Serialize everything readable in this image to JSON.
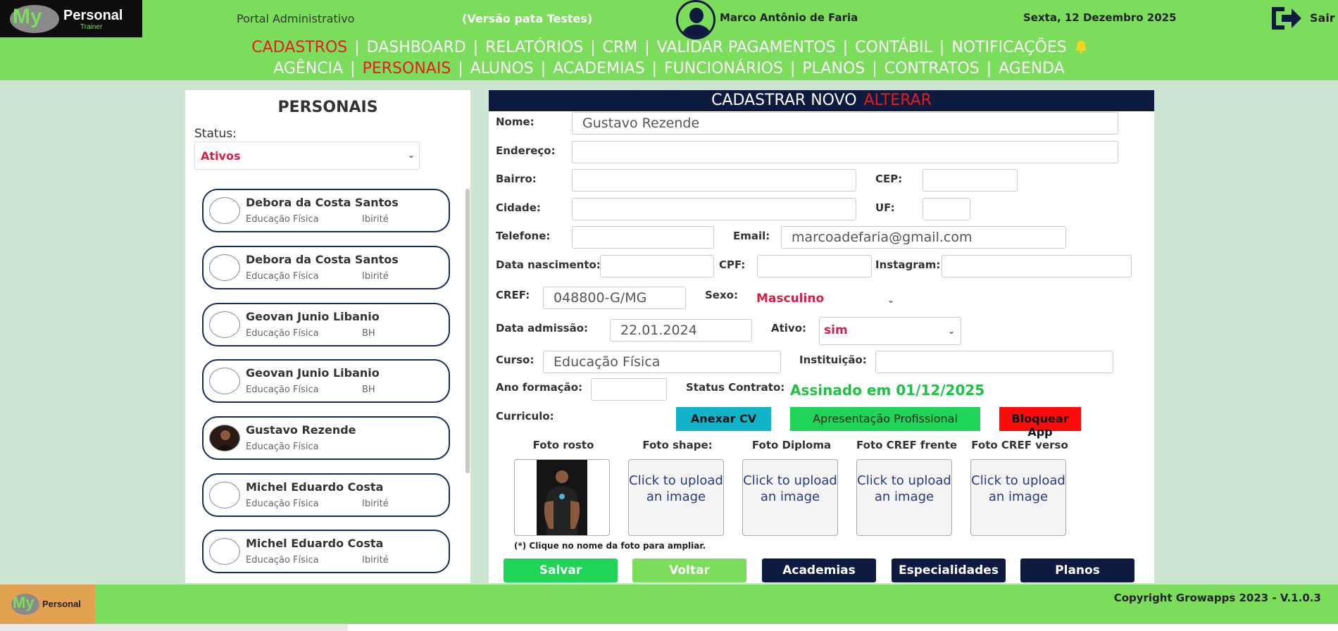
{
  "header": {
    "logo_my": "My",
    "logo_personal": "Personal",
    "logo_trainer": "Trainer",
    "portal": "Portal Administrativo",
    "versao": "(Versão pata Testes)",
    "user_name": "Marco Antônio de Faria",
    "date": "Sexta, 12 Dezembro 2025",
    "exit_label": "Sair"
  },
  "nav_primary": [
    "CADASTROS",
    "DASHBOARD",
    "RELATÓRIOS",
    "CRM",
    "VALIDAR PAGAMENTOS",
    "CONTÁBIL",
    "NOTIFICAÇÕES"
  ],
  "nav_secondary": [
    "AGÊNCIA",
    "PERSONAIS",
    "ALUNOS",
    "ACADEMIAS",
    "FUNCIONÁRIOS",
    "PLANOS",
    "CONTRATOS",
    "AGENDA"
  ],
  "separator": "|",
  "left": {
    "title": "PERSONAIS",
    "status_label": "Status:",
    "status_value": "Ativos",
    "list": [
      {
        "name": "Debora da Costa Santos",
        "curso": "Educação Física",
        "city": "Ibirité"
      },
      {
        "name": "Debora da Costa Santos",
        "curso": "Educação Física",
        "city": "Ibirité"
      },
      {
        "name": "Geovan Junio Libanio",
        "curso": "Educação Física",
        "city": "BH"
      },
      {
        "name": "Geovan Junio Libanio",
        "curso": "Educação Física",
        "city": "BH"
      },
      {
        "name": "Gustavo Rezende",
        "curso": "Educação Física",
        "city": ""
      },
      {
        "name": "Michel Eduardo Costa",
        "curso": "Educação Física",
        "city": "Ibirité"
      },
      {
        "name": "Michel Eduardo Costa",
        "curso": "Educação Física",
        "city": "Ibirité"
      }
    ]
  },
  "form": {
    "header_new": "CADASTRAR NOVO",
    "header_alter": "ALTERAR",
    "labels": {
      "nome": "Nome:",
      "endereco": "Endereço:",
      "bairro": "Bairro:",
      "cep": "CEP:",
      "cidade": "Cidade:",
      "uf": "UF:",
      "telefone": "Telefone:",
      "email": "Email:",
      "nascimento": "Data nascimento:",
      "cpf": "CPF:",
      "instagram": "Instagram:",
      "cref": "CREF:",
      "sexo": "Sexo:",
      "admissao": "Data admissão:",
      "ativo": "Ativo:",
      "curso": "Curso:",
      "instituicao": "Instituição:",
      "ano_formacao": "Ano formação:",
      "status_contrato": "Status Contrato:",
      "curriculo": "Curriculo:"
    },
    "values": {
      "nome": "Gustavo Rezende",
      "endereco": "",
      "bairro": "",
      "cep": "",
      "cidade": "",
      "uf": "",
      "telefone": "",
      "email": "marcoadefaria@gmail.com",
      "nascimento": "",
      "cpf": "",
      "instagram": "",
      "cref": "048800-G/MG",
      "sexo": "Masculino",
      "admissao": "22.01.2024",
      "ativo": "sim",
      "curso": "Educação Física",
      "instituicao": "",
      "ano_formacao": "",
      "status_contrato": "Assinado em 01/12/2025"
    },
    "buttons_cv": {
      "anexar": "Anexar CV",
      "apresentacao": "Apresentação Profissional",
      "bloquear": "Bloquear App"
    },
    "photos": {
      "rosto": "Foto rosto",
      "shape": "Foto shape:",
      "diploma": "Foto Diploma",
      "cref_frente": "Foto CREF frente",
      "cref_verso": "Foto CREF verso",
      "upload_text": "Click to upload an image"
    },
    "hint": "(*) Clique no nome da foto para ampliar.",
    "actions": {
      "salvar": "Salvar",
      "voltar": "Voltar",
      "academias": "Academias",
      "especialidades": "Especialidades",
      "planos": "Planos"
    }
  },
  "footer": {
    "logo_my": "My",
    "logo_personal": "Personal",
    "copyright": "Copyright Growapps 2023 - V.1.0.3"
  },
  "colors": {
    "green": "#7cdc5c",
    "navy": "#0e1a40",
    "red": "#e41e1e",
    "cyan": "#12b2c8",
    "bright_green": "#1fd456"
  }
}
